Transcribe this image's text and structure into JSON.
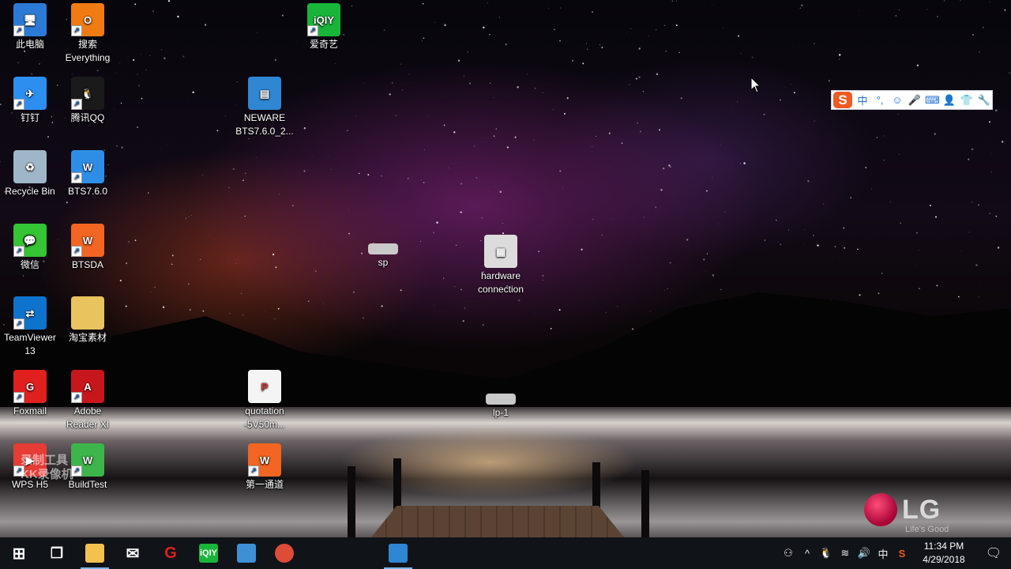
{
  "desktop": {
    "icons": [
      {
        "id": "this-pc",
        "label": "此电脑",
        "color": "#2b7bd6"
      },
      {
        "id": "search-everything",
        "label": "搜索\nEverything",
        "color": "#f07b12"
      },
      {
        "id": "iqiyi",
        "label": "爱奇艺",
        "color": "#19b53a"
      },
      {
        "id": "dingtalk",
        "label": "钉钉",
        "color": "#2c8ff0"
      },
      {
        "id": "qq",
        "label": "腾讯QQ",
        "color": "#1a1a1a"
      },
      {
        "id": "neware-zip",
        "label": "NEWARE\nBTS7.6.0_2...",
        "color": "#2f86d2"
      },
      {
        "id": "recycle-bin",
        "label": "Recycle Bin",
        "color": "#9fb6c8"
      },
      {
        "id": "bts760",
        "label": "BTS7.6.0",
        "color": "#2e8ee6"
      },
      {
        "id": "wechat",
        "label": "微信",
        "color": "#34c434"
      },
      {
        "id": "btsda",
        "label": "BTSDA",
        "color": "#f26522"
      },
      {
        "id": "sp",
        "label": "sp",
        "color": "#c9c9c9"
      },
      {
        "id": "hardware-connection",
        "label": "hardware\nconnection",
        "color": "#dcdcdc"
      },
      {
        "id": "teamviewer",
        "label": "TeamViewer\n13",
        "color": "#0e73cc"
      },
      {
        "id": "taobao-folder",
        "label": "淘宝素材",
        "color": "#e8c35e"
      },
      {
        "id": "foxmail",
        "label": "Foxmail",
        "color": "#e0201e"
      },
      {
        "id": "adobe-reader",
        "label": "Adobe\nReader XI",
        "color": "#c8161d"
      },
      {
        "id": "quotation",
        "label": "quotation\n-5V50m...",
        "color": "#f4f4f4"
      },
      {
        "id": "lp1",
        "label": "lp-1",
        "color": "#c9c9c9"
      },
      {
        "id": "wps",
        "label": "WPS H5",
        "color": "#e63c36"
      },
      {
        "id": "buildtest",
        "label": "BuildTest",
        "color": "#3db54a"
      },
      {
        "id": "first-channel",
        "label": "第一通道",
        "color": "#f26522"
      }
    ],
    "watermark": "录制工具\nKK录像机"
  },
  "ime": {
    "logo": "S",
    "items": [
      "中",
      "°,",
      "☺",
      "🎤",
      "⌨",
      "👤",
      "👕",
      "🔧"
    ]
  },
  "brand": {
    "name": "LG",
    "tagline": "Life's Good"
  },
  "taskbar": {
    "apps": [
      {
        "id": "start",
        "symbol": "⊞",
        "color": "#101318"
      },
      {
        "id": "task-view",
        "symbol": "❐",
        "color": "#101318"
      },
      {
        "id": "file-explorer",
        "symbol": "",
        "color": "#f2c14e"
      },
      {
        "id": "mail",
        "symbol": "✉",
        "color": "#101318"
      },
      {
        "id": "foxmail",
        "symbol": "G",
        "color": "#101318"
      },
      {
        "id": "iqiyi",
        "symbol": "iQIY",
        "color": "#19b53a"
      },
      {
        "id": "control",
        "symbol": "",
        "color": "#3d8fd6"
      },
      {
        "id": "chrome",
        "symbol": "",
        "color": "#dd4b39"
      },
      {
        "id": "everything",
        "symbol": "",
        "color": "#101318"
      },
      {
        "id": "photos",
        "symbol": "",
        "color": "#101318"
      },
      {
        "id": "neware",
        "symbol": "",
        "color": "#2f86d2"
      }
    ],
    "tray": {
      "people": "⚇",
      "chevron": "^",
      "qq": "🐧",
      "wifi": "≋",
      "volume": "🔊",
      "lang": "中",
      "sogou": "S",
      "time": "11:34 PM",
      "date": "4/29/2018",
      "notifications": "🗨"
    }
  }
}
